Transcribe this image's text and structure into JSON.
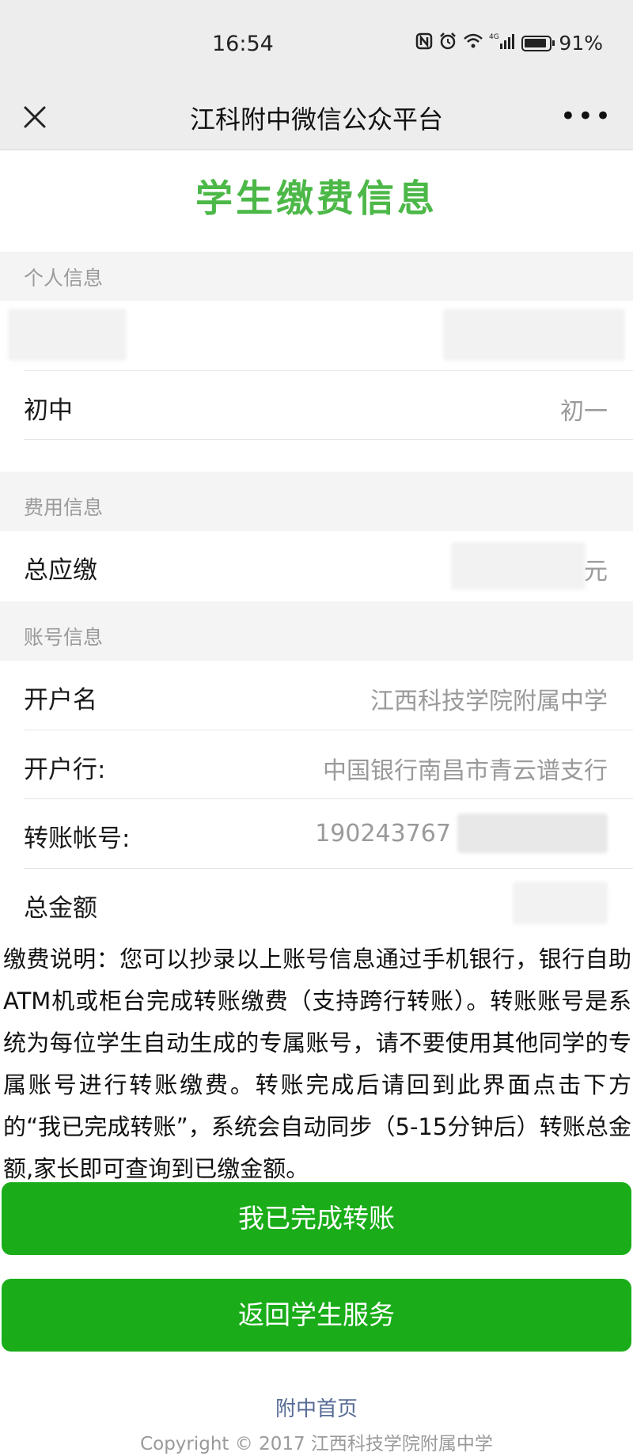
{
  "status_bar": {
    "time": "16:54",
    "battery": "91%",
    "network": "4G"
  },
  "nav": {
    "title": "江科附中微信公众平台",
    "more": "•••"
  },
  "page_title": "学生缴费信息",
  "personal": {
    "section_label": "个人信息",
    "grade_label": "初中",
    "grade_value": "初一"
  },
  "fee": {
    "section_label": "费用信息",
    "total_due_label": "总应缴",
    "total_due_value": "元"
  },
  "account": {
    "section_label": "账号信息",
    "name_label": "开户名",
    "name_value": "江西科技学院附属中学",
    "bank_label": "开户行:",
    "bank_value": "中国银行南昌市青云谱支行",
    "number_label": "转账帐号:",
    "number_value": "190243767",
    "total_label": "总金额"
  },
  "notice": "缴费说明：您可以抄录以上账号信息通过手机银行，银行自助ATM机或柜台完成转账缴费（支持跨行转账）。转账账号是系统为每位学生自动生成的专属账号，请不要使用其他同学的专属账号进行转账缴费。转账完成后请回到此界面点击下方的“我已完成转账”，系统会自动同步（5-15分钟后）转账总金额,家长即可查询到已缴金额。",
  "buttons": {
    "done": "我已完成转账",
    "back": "返回学生服务"
  },
  "footer": {
    "home_link": "附中首页",
    "copyright": "Copyright © 2017 江西科技学院附属中学"
  },
  "colors": {
    "title_green": "#4cb848",
    "button_green": "#1aad19",
    "link_blue": "#576b95",
    "nav_bg": "#ededed"
  }
}
